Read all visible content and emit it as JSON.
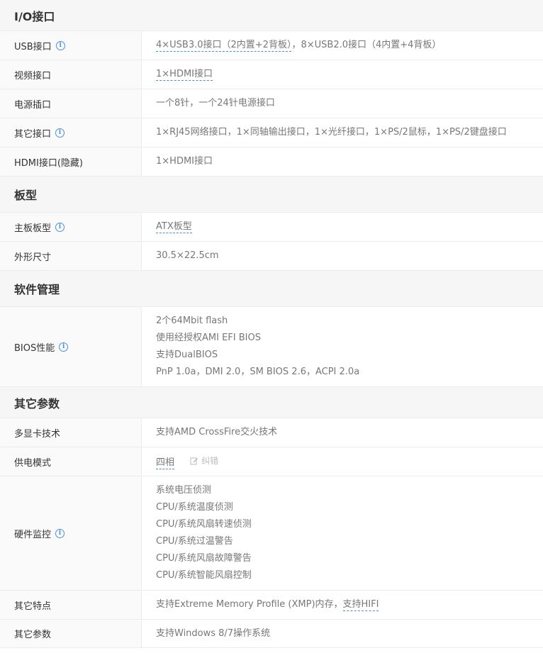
{
  "sections": [
    {
      "title": "I/O接口",
      "rows": [
        {
          "label": "USB接口",
          "info": true,
          "lines": [
            [
              "4×USB3.0接口（2内置+2背板）",
              "，8×USB2.0接口（4内置+4背板）"
            ]
          ]
        },
        {
          "label": "视频接口",
          "info": false,
          "lines": [
            [
              "1×HDMI接口"
            ]
          ]
        },
        {
          "label": "电源插口",
          "info": false,
          "lines": [
            [
              "一个8针，一个24针电源接口"
            ]
          ]
        },
        {
          "label": "其它接口",
          "info": true,
          "lines": [
            [
              "1×RJ45网络接口，1×同轴输出接口，1×光纤接口，1×PS/2鼠标，1×PS/2键盘接口"
            ]
          ]
        },
        {
          "label": "HDMI接口(隐藏)",
          "info": false,
          "lines": [
            [
              "1×HDMI接口"
            ]
          ]
        }
      ]
    },
    {
      "title": "板型",
      "rows": [
        {
          "label": "主板板型",
          "info": true,
          "lines": [
            [
              "ATX板型"
            ]
          ]
        },
        {
          "label": "外形尺寸",
          "info": false,
          "lines": [
            [
              "30.5×22.5cm"
            ]
          ]
        }
      ]
    },
    {
      "title": "软件管理",
      "rows": [
        {
          "label": "BIOS性能",
          "info": true,
          "lines": [
            [
              "2个64Mbit flash"
            ],
            [
              "使用经授权AMI EFI BIOS"
            ],
            [
              "支持DualBIOS"
            ],
            [
              "PnP 1.0a，DMI 2.0，SM BIOS 2.6，ACPI 2.0a"
            ]
          ]
        }
      ]
    },
    {
      "title": "其它参数",
      "rows": [
        {
          "label": "多显卡技术",
          "info": false,
          "lines": [
            [
              "支持AMD CrossFire交火技术"
            ]
          ]
        },
        {
          "label": "供电模式",
          "info": false,
          "lines": [
            [
              "四相"
            ]
          ],
          "correct": "纠错"
        },
        {
          "label": "硬件监控",
          "info": true,
          "lines": [
            [
              "系统电压侦测"
            ],
            [
              "CPU/系统温度侦测"
            ],
            [
              "CPU/系统风扇转速侦测"
            ],
            [
              "CPU/系统过温警告"
            ],
            [
              "CPU/系统风扇故障警告"
            ],
            [
              "CPU/系统智能风扇控制"
            ]
          ]
        },
        {
          "label": "其它特点",
          "info": false,
          "lines": [
            [
              "支持Extreme Memory Profile (XMP)内存，",
              "支持HIFI"
            ]
          ]
        },
        {
          "label": "其它参数",
          "info": false,
          "lines": [
            [
              "支持Windows 8/7操作系统"
            ]
          ]
        }
      ]
    }
  ]
}
